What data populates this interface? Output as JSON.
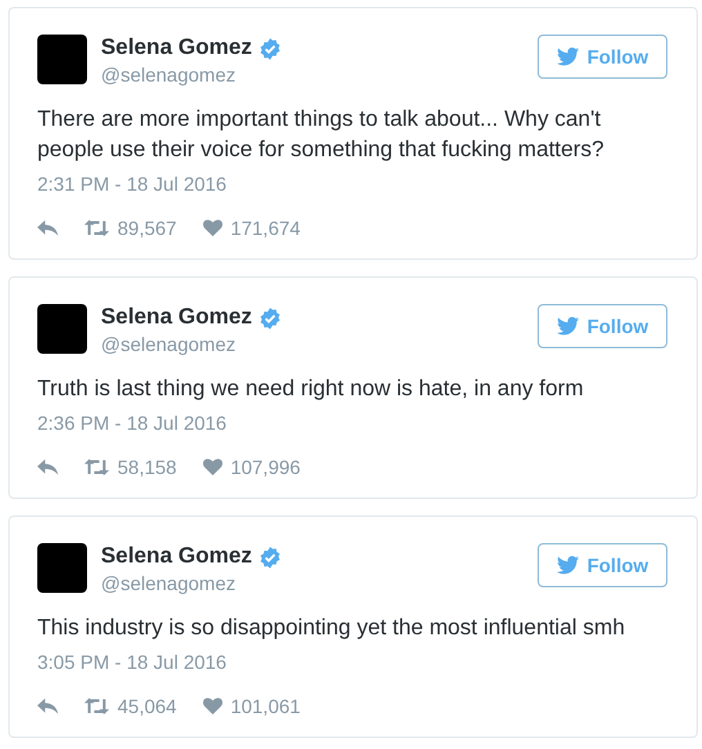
{
  "tweets": [
    {
      "name": "Selena Gomez",
      "verified": true,
      "handle": "@selenagomez",
      "follow": "Follow",
      "text": "There are more important things to talk about... Why can't people use their voice for something that fucking matters?",
      "time": "2:31 PM - 18 Jul 2016",
      "retweets": "89,567",
      "likes": "171,674"
    },
    {
      "name": "Selena Gomez",
      "verified": true,
      "handle": "@selenagomez",
      "follow": "Follow",
      "text": "Truth is last thing we need right now is hate, in any form",
      "time": "2:36 PM - 18 Jul 2016",
      "retweets": "58,158",
      "likes": "107,996"
    },
    {
      "name": "Selena Gomez",
      "verified": true,
      "handle": "@selenagomez",
      "follow": "Follow",
      "text": "This industry is so disappointing yet the most influential smh",
      "time": "3:05 PM - 18 Jul 2016",
      "retweets": "45,064",
      "likes": "101,061"
    }
  ]
}
